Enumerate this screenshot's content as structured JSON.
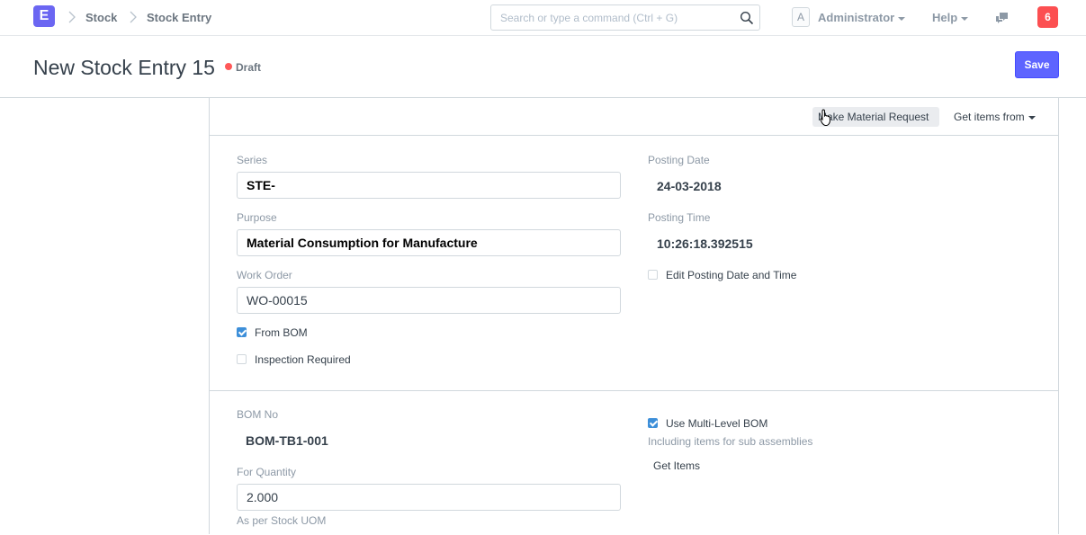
{
  "navbar": {
    "logo_letter": "E",
    "breadcrumbs": [
      "Stock",
      "Stock Entry"
    ],
    "search_placeholder": "Search or type a command (Ctrl + G)",
    "avatar_letter": "A",
    "user_menu": "Administrator",
    "help_menu": "Help",
    "notification_count": "6"
  },
  "page": {
    "title": "New Stock Entry 15",
    "status": "Draft",
    "save_label": "Save"
  },
  "toolbar": {
    "make_material_request": "Make Material Request",
    "get_items_from": "Get items from"
  },
  "section1": {
    "series_label": "Series",
    "series_value": "STE-",
    "purpose_label": "Purpose",
    "purpose_value": "Material Consumption for Manufacture",
    "work_order_label": "Work Order",
    "work_order_value": "WO-00015",
    "from_bom_label": "From BOM",
    "from_bom_checked": true,
    "inspection_label": "Inspection Required",
    "inspection_checked": false,
    "posting_date_label": "Posting Date",
    "posting_date_value": "24-03-2018",
    "posting_time_label": "Posting Time",
    "posting_time_value": "10:26:18.392515",
    "edit_posting_label": "Edit Posting Date and Time",
    "edit_posting_checked": false
  },
  "section2": {
    "bom_no_label": "BOM No",
    "bom_no_value": "BOM-TB1-001",
    "for_quantity_label": "For Quantity",
    "for_quantity_value": "2.000",
    "for_quantity_help": "As per Stock UOM",
    "multi_level_label": "Use Multi-Level BOM",
    "multi_level_checked": true,
    "multi_level_help": "Including items for sub assemblies",
    "get_items_label": "Get Items"
  },
  "colors": {
    "primary": "#5e64ff",
    "indicator_red": "#ff5858",
    "notification": "#fc4f51",
    "checkbox_blue": "#3d8fd9"
  }
}
